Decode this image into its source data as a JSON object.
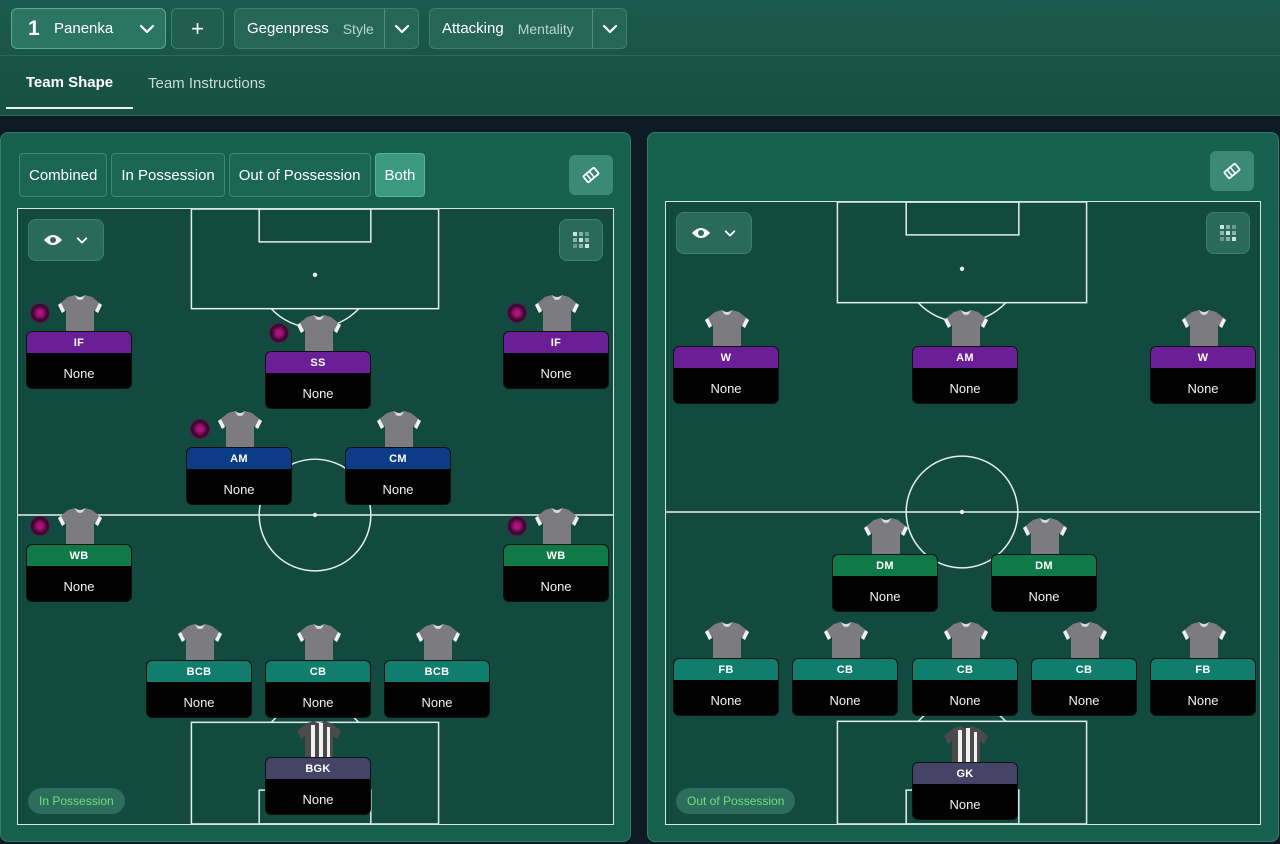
{
  "header": {
    "tactic_number": "1",
    "tactic_name": "Panenka",
    "add_label": "+",
    "style_value": "Gegenpress",
    "style_label": "Style",
    "mentality_value": "Attacking",
    "mentality_label": "Mentality"
  },
  "tabs": [
    {
      "label": "Team Shape",
      "active": true
    },
    {
      "label": "Team Instructions",
      "active": false
    }
  ],
  "left_panel": {
    "segments": [
      {
        "label": "Combined",
        "active": false
      },
      {
        "label": "In Possession",
        "active": false
      },
      {
        "label": "Out of Possession",
        "active": false
      },
      {
        "label": "Both",
        "active": true
      }
    ],
    "phase_label": "In Possession",
    "players": [
      {
        "role": "IF",
        "name": "None",
        "line": "att",
        "badge": true
      },
      {
        "role": "SS",
        "name": "None",
        "line": "att",
        "badge": true
      },
      {
        "role": "IF",
        "name": "None",
        "line": "att",
        "badge": true
      },
      {
        "role": "AM",
        "name": "None",
        "line": "mid",
        "badge": true
      },
      {
        "role": "CM",
        "name": "None",
        "line": "mid",
        "badge": false
      },
      {
        "role": "WB",
        "name": "None",
        "line": "def-g",
        "badge": true
      },
      {
        "role": "WB",
        "name": "None",
        "line": "def-g",
        "badge": true
      },
      {
        "role": "BCB",
        "name": "None",
        "line": "def-t",
        "badge": false
      },
      {
        "role": "CB",
        "name": "None",
        "line": "def-t",
        "badge": false
      },
      {
        "role": "BCB",
        "name": "None",
        "line": "def-t",
        "badge": false
      },
      {
        "role": "BGK",
        "name": "None",
        "line": "gk",
        "badge": false
      }
    ]
  },
  "right_panel": {
    "phase_label": "Out of Possession",
    "players": [
      {
        "role": "W",
        "name": "None",
        "line": "att",
        "badge": false
      },
      {
        "role": "AM",
        "name": "None",
        "line": "att",
        "badge": false
      },
      {
        "role": "W",
        "name": "None",
        "line": "att",
        "badge": false
      },
      {
        "role": "DM",
        "name": "None",
        "line": "def-g",
        "badge": false
      },
      {
        "role": "DM",
        "name": "None",
        "line": "def-g",
        "badge": false
      },
      {
        "role": "FB",
        "name": "None",
        "line": "def-t",
        "badge": false
      },
      {
        "role": "CB",
        "name": "None",
        "line": "def-t",
        "badge": false
      },
      {
        "role": "CB",
        "name": "None",
        "line": "def-t",
        "badge": false
      },
      {
        "role": "CB",
        "name": "None",
        "line": "def-t",
        "badge": false
      },
      {
        "role": "FB",
        "name": "None",
        "line": "def-t",
        "badge": false
      },
      {
        "role": "GK",
        "name": "None",
        "line": "gk",
        "badge": false
      }
    ]
  },
  "icons": {
    "chevron": "chevron-down-icon",
    "eye": "eye-icon",
    "grid": "grid-icon",
    "tactics": "tactics-board-icon",
    "shirt": "shirt-icon"
  },
  "colors": {
    "attack_role": "#6a1f96",
    "midfield_role": "#0c3c86",
    "defence_green_role": "#0f7a47",
    "defence_teal_role": "#107d6d",
    "goalkeeper_role": "#464466",
    "phase_text": "#6fe07e"
  }
}
